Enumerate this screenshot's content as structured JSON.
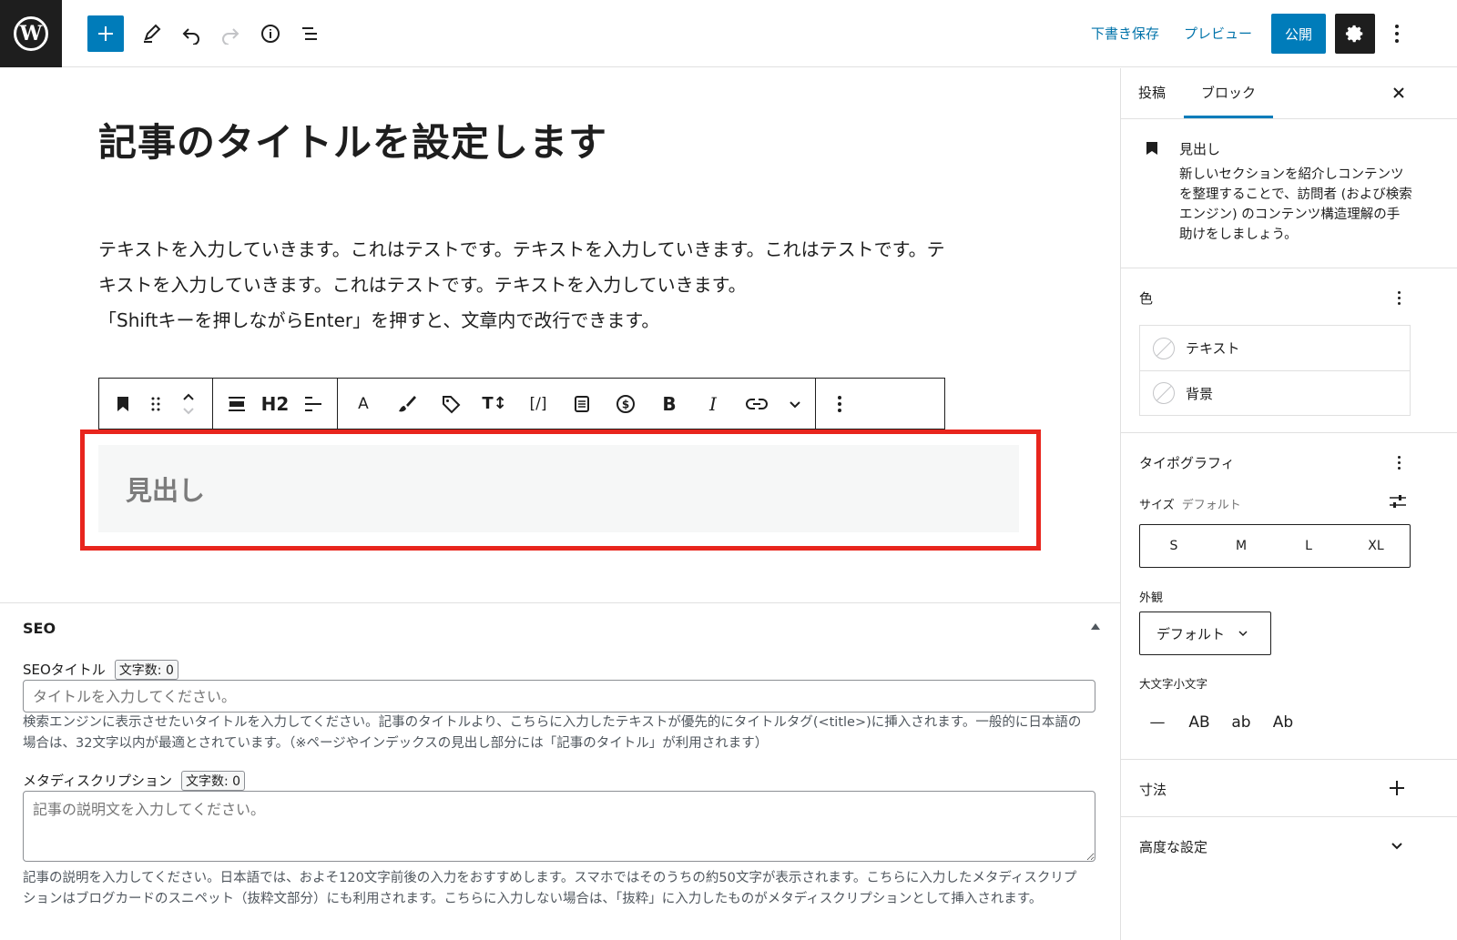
{
  "topbar": {
    "save_draft": "下書き保存",
    "preview": "プレビュー",
    "publish": "公開"
  },
  "editor": {
    "post_title": "記事のタイトルを設定します",
    "paragraph_lines": [
      "テキストを入力していきます。これはテストです。テキストを入力していきます。これはテストです。テ",
      "キストを入力していきます。これはテストです。テキストを入力していきます。",
      "「Shiftキーを押しながらEnter」を押すと、文章内で改行できます。"
    ],
    "toolbar": {
      "heading_level": "H2",
      "text_color_label": "A",
      "bold_label": "B",
      "italic_label": "I",
      "shortcode_label": "[/]",
      "font_size_label": "T↕"
    },
    "heading_placeholder": "見出し"
  },
  "seo": {
    "section_title": "SEO",
    "title_label": "SEOタイトル",
    "title_count": "文字数: 0",
    "title_placeholder": "タイトルを入力してください。",
    "title_help": "検索エンジンに表示させたいタイトルを入力してください。記事のタイトルより、こちらに入力したテキストが優先的にタイトルタグ(<title>)に挿入されます。一般的に日本語の場合は、32文字以内が最適とされています。（※ページやインデックスの見出し部分には「記事のタイトル」が利用されます）",
    "desc_label": "メタディスクリプション",
    "desc_count": "文字数: 0",
    "desc_placeholder": "記事の説明文を入力してください。",
    "desc_help": "記事の説明を入力してください。日本語では、およそ120文字前後の入力をおすすめします。スマホではそのうちの約50文字が表示されます。こちらに入力したメタディスクリプションはブログカードのスニペット（抜粋文部分）にも利用されます。こちらに入力しない場合は、「抜粋」に入力したものがメタディスクリプションとして挿入されます。"
  },
  "sidebar": {
    "tab_post": "投稿",
    "tab_block": "ブロック",
    "block_name": "見出し",
    "block_desc": "新しいセクションを紹介しコンテンツを整理することで、訪問者 (および検索エンジン) のコンテンツ構造理解の手助けをしましょう。",
    "color_title": "色",
    "color_items": [
      "テキスト",
      "背景"
    ],
    "typography_title": "タイポグラフィ",
    "size_label": "サイズ",
    "size_value": "デフォルト",
    "sizes": [
      "S",
      "M",
      "L",
      "XL"
    ],
    "appearance_label": "外観",
    "appearance_value": "デフォルト",
    "case_label": "大文字小文字",
    "case_options": [
      "—",
      "AB",
      "ab",
      "Ab"
    ],
    "dimensions_title": "寸法",
    "advanced_title": "高度な設定"
  },
  "colors": {
    "accent": "#007cba",
    "highlight": "#e8251d",
    "dark": "#1e1e1e"
  }
}
